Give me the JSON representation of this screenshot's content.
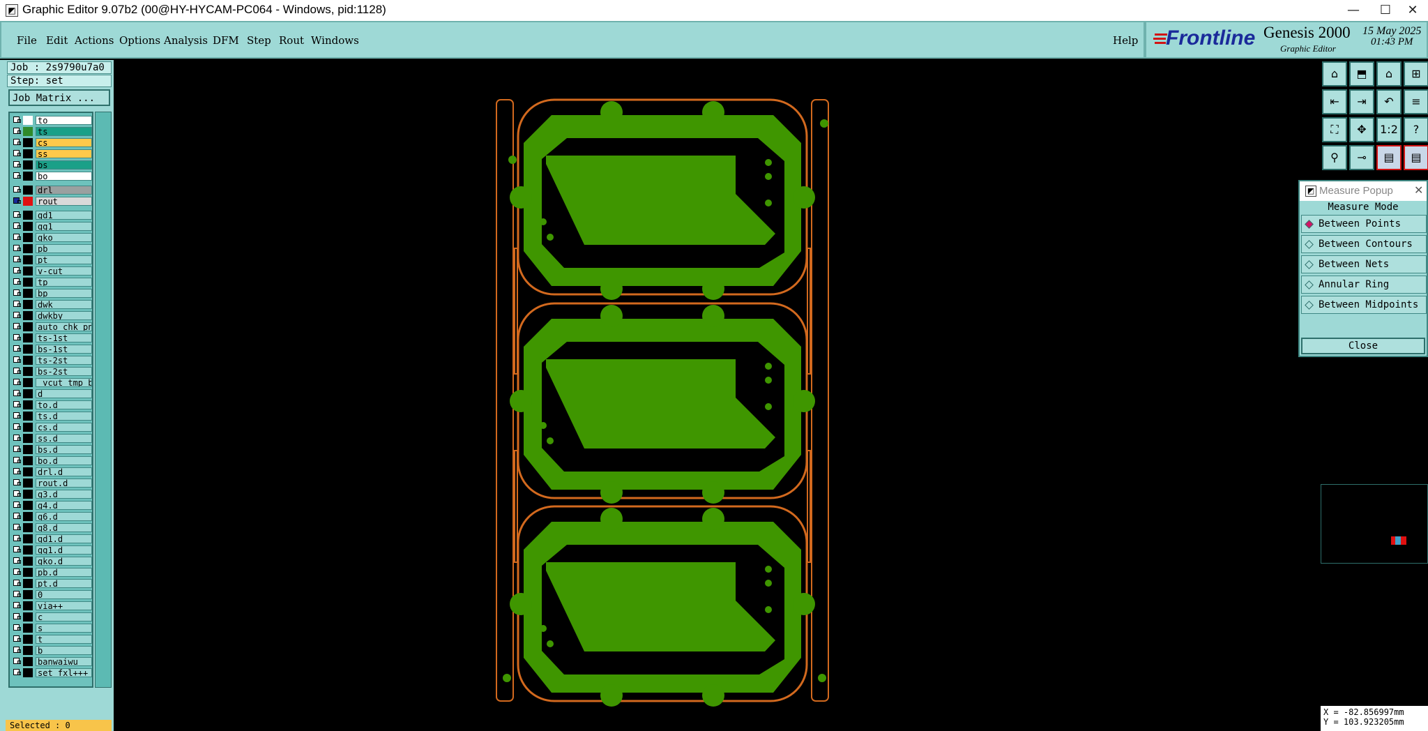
{
  "window": {
    "title": "Graphic Editor 9.07b2 (00@HY-HYCAM-PC064 - Windows, pid:1128)",
    "minimize": "—",
    "maximize": "☐",
    "close": "✕"
  },
  "menubar": {
    "items": [
      "File",
      "Edit",
      "Actions",
      "Options",
      "Analysis",
      "DFM",
      "Step",
      "Rout",
      "Windows"
    ],
    "help": "Help"
  },
  "logo": {
    "brand": "Frontline",
    "product": "Genesis 2000",
    "subtitle": "Graphic Editor",
    "date": "15 May 2025",
    "time": "01:43 PM"
  },
  "job": {
    "job_label": "Job : 2s9790u7a0",
    "step_label": "Step: set",
    "matrix_button": "Job Matrix ..."
  },
  "layers": [
    {
      "name": "to",
      "color": "#ffffff",
      "bg": "#ffffff"
    },
    {
      "name": "ts",
      "color": "#2f8a2a",
      "bg": "#1aa088"
    },
    {
      "name": "cs",
      "color": "#000000",
      "bg": "#ffc94a"
    },
    {
      "name": "ss",
      "color": "#000000",
      "bg": "#ffc94a"
    },
    {
      "name": "bs",
      "color": "#000000",
      "bg": "#1aa088"
    },
    {
      "name": "bo",
      "color": "#000000",
      "bg": "#ffffff"
    },
    {
      "name": "drl",
      "color": "#000000",
      "bg": "#9aa0a0"
    },
    {
      "name": "rout",
      "color": "#e01010",
      "bg": "#d9d9d9",
      "checked": true
    },
    {
      "name": "gd1",
      "color": "#000000",
      "bg": "#9ed9d6"
    },
    {
      "name": "gg1",
      "color": "#000000",
      "bg": "#9ed9d6"
    },
    {
      "name": "gko",
      "color": "#000000",
      "bg": "#9ed9d6"
    },
    {
      "name": "pb",
      "color": "#000000",
      "bg": "#9ed9d6"
    },
    {
      "name": "pt",
      "color": "#000000",
      "bg": "#9ed9d6"
    },
    {
      "name": "v-cut",
      "color": "#000000",
      "bg": "#9ed9d6"
    },
    {
      "name": "tp",
      "color": "#000000",
      "bg": "#9ed9d6"
    },
    {
      "name": "bp",
      "color": "#000000",
      "bg": "#9ed9d6"
    },
    {
      "name": "dwk",
      "color": "#000000",
      "bg": "#9ed9d6"
    },
    {
      "name": "dwkby",
      "color": "#000000",
      "bg": "#9ed9d6"
    },
    {
      "name": "auto_chk_pn.",
      "color": "#000000",
      "bg": "#9ed9d6"
    },
    {
      "name": "ts-1st",
      "color": "#000000",
      "bg": "#9ed9d6"
    },
    {
      "name": "bs-1st",
      "color": "#000000",
      "bg": "#9ed9d6"
    },
    {
      "name": "ts-2st",
      "color": "#000000",
      "bg": "#9ed9d6"
    },
    {
      "name": "bs-2st",
      "color": "#000000",
      "bg": "#9ed9d6"
    },
    {
      "name": "_vcut_tmp_ba",
      "color": "#000000",
      "bg": "#9ed9d6"
    },
    {
      "name": "d",
      "color": "#000000",
      "bg": "#9ed9d6"
    },
    {
      "name": "to.d",
      "color": "#000000",
      "bg": "#9ed9d6"
    },
    {
      "name": "ts.d",
      "color": "#000000",
      "bg": "#9ed9d6"
    },
    {
      "name": "cs.d",
      "color": "#000000",
      "bg": "#9ed9d6"
    },
    {
      "name": "ss.d",
      "color": "#000000",
      "bg": "#9ed9d6"
    },
    {
      "name": "bs.d",
      "color": "#000000",
      "bg": "#9ed9d6"
    },
    {
      "name": "bo.d",
      "color": "#000000",
      "bg": "#9ed9d6"
    },
    {
      "name": "drl.d",
      "color": "#000000",
      "bg": "#9ed9d6"
    },
    {
      "name": "rout.d",
      "color": "#000000",
      "bg": "#9ed9d6"
    },
    {
      "name": "g3.d",
      "color": "#000000",
      "bg": "#9ed9d6"
    },
    {
      "name": "g4.d",
      "color": "#000000",
      "bg": "#9ed9d6"
    },
    {
      "name": "g6.d",
      "color": "#000000",
      "bg": "#9ed9d6"
    },
    {
      "name": "g8.d",
      "color": "#000000",
      "bg": "#9ed9d6"
    },
    {
      "name": "gd1.d",
      "color": "#000000",
      "bg": "#9ed9d6"
    },
    {
      "name": "gg1.d",
      "color": "#000000",
      "bg": "#9ed9d6"
    },
    {
      "name": "gko.d",
      "color": "#000000",
      "bg": "#9ed9d6"
    },
    {
      "name": "pb.d",
      "color": "#000000",
      "bg": "#9ed9d6"
    },
    {
      "name": "pt.d",
      "color": "#000000",
      "bg": "#9ed9d6"
    },
    {
      "name": "0",
      "color": "#000000",
      "bg": "#9ed9d6"
    },
    {
      "name": "via++",
      "color": "#000000",
      "bg": "#9ed9d6"
    },
    {
      "name": "c",
      "color": "#000000",
      "bg": "#9ed9d6"
    },
    {
      "name": "s",
      "color": "#000000",
      "bg": "#9ed9d6"
    },
    {
      "name": "t",
      "color": "#000000",
      "bg": "#9ed9d6"
    },
    {
      "name": "b",
      "color": "#000000",
      "bg": "#9ed9d6"
    },
    {
      "name": "banwaiwu",
      "color": "#000000",
      "bg": "#9ed9d6"
    },
    {
      "name": "set_fxl+++",
      "color": "#000000",
      "bg": "#9ed9d6"
    }
  ],
  "status": {
    "selected": "Selected : 0"
  },
  "measure_popup": {
    "title": "Measure Popup",
    "section": "Measure Mode",
    "options": [
      "Between Points",
      "Between Contours",
      "Between Nets",
      "Annular Ring",
      "Between Midpoints"
    ],
    "selected_index": 0,
    "close_label": "Close"
  },
  "toolbar": {
    "icons": [
      "zoom-home-icon",
      "zoom-in-icon",
      "zoom-fit-icon",
      "window-icon",
      "pan-left-icon",
      "pan-right-icon",
      "undo-view-icon",
      "snap-icon",
      "zoom-extents-icon",
      "center-icon",
      "scale-1-2-icon",
      "help-query-icon",
      "connect-icon",
      "measure-icon",
      "layer-compare-icon",
      "layer-compare-2-icon"
    ],
    "ratio_label": "1:2",
    "query_label": "?"
  },
  "coords": {
    "x": "X = -82.856997mm",
    "y": "Y = 103.923205mm"
  },
  "colors": {
    "panel": "#9ed9d6",
    "copper": "#3f9600",
    "rout": "#d2691e",
    "canvas": "#000000"
  }
}
